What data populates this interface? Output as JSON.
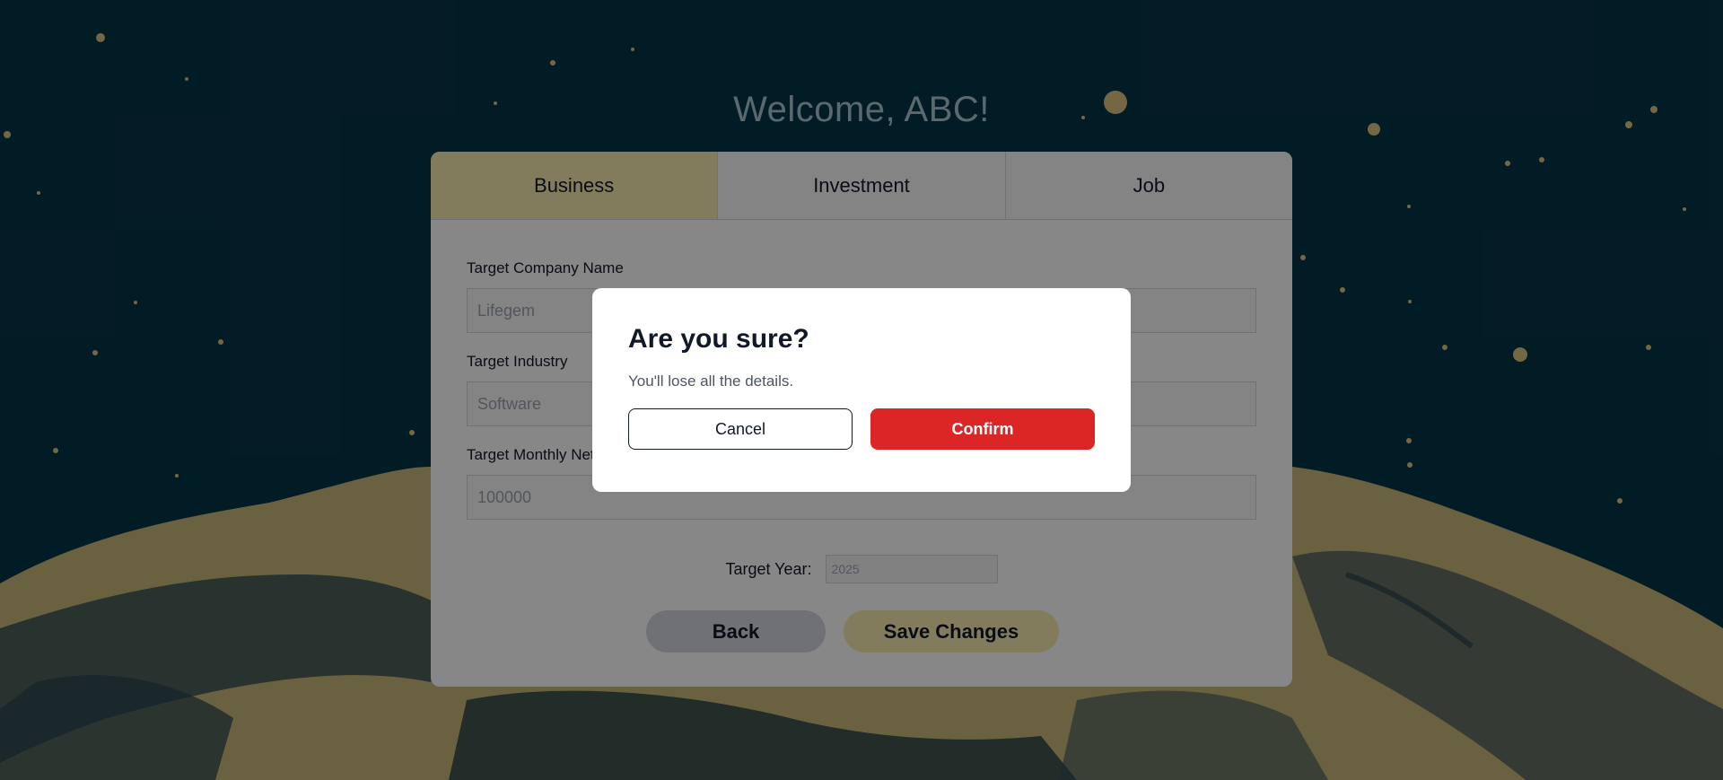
{
  "page": {
    "welcome": "Welcome, ABC!"
  },
  "tabs": [
    {
      "label": "Business",
      "active": true
    },
    {
      "label": "Investment",
      "active": false
    },
    {
      "label": "Job",
      "active": false
    }
  ],
  "form": {
    "company_label": "Target Company Name",
    "company_value": "Lifegem",
    "industry_label": "Target Industry",
    "industry_value": "Software",
    "income_label": "Target Monthly Net Income",
    "income_value": "100000",
    "year_label": "Target Year:",
    "year_value": "2025",
    "back_label": "Back",
    "save_label": "Save Changes"
  },
  "modal": {
    "title": "Are you sure?",
    "message": "You'll lose all the details.",
    "cancel_label": "Cancel",
    "confirm_label": "Confirm"
  },
  "colors": {
    "background": "#053547",
    "sand": "#c9b87a",
    "active_tab": "#f5eab0",
    "confirm": "#dc2626"
  }
}
